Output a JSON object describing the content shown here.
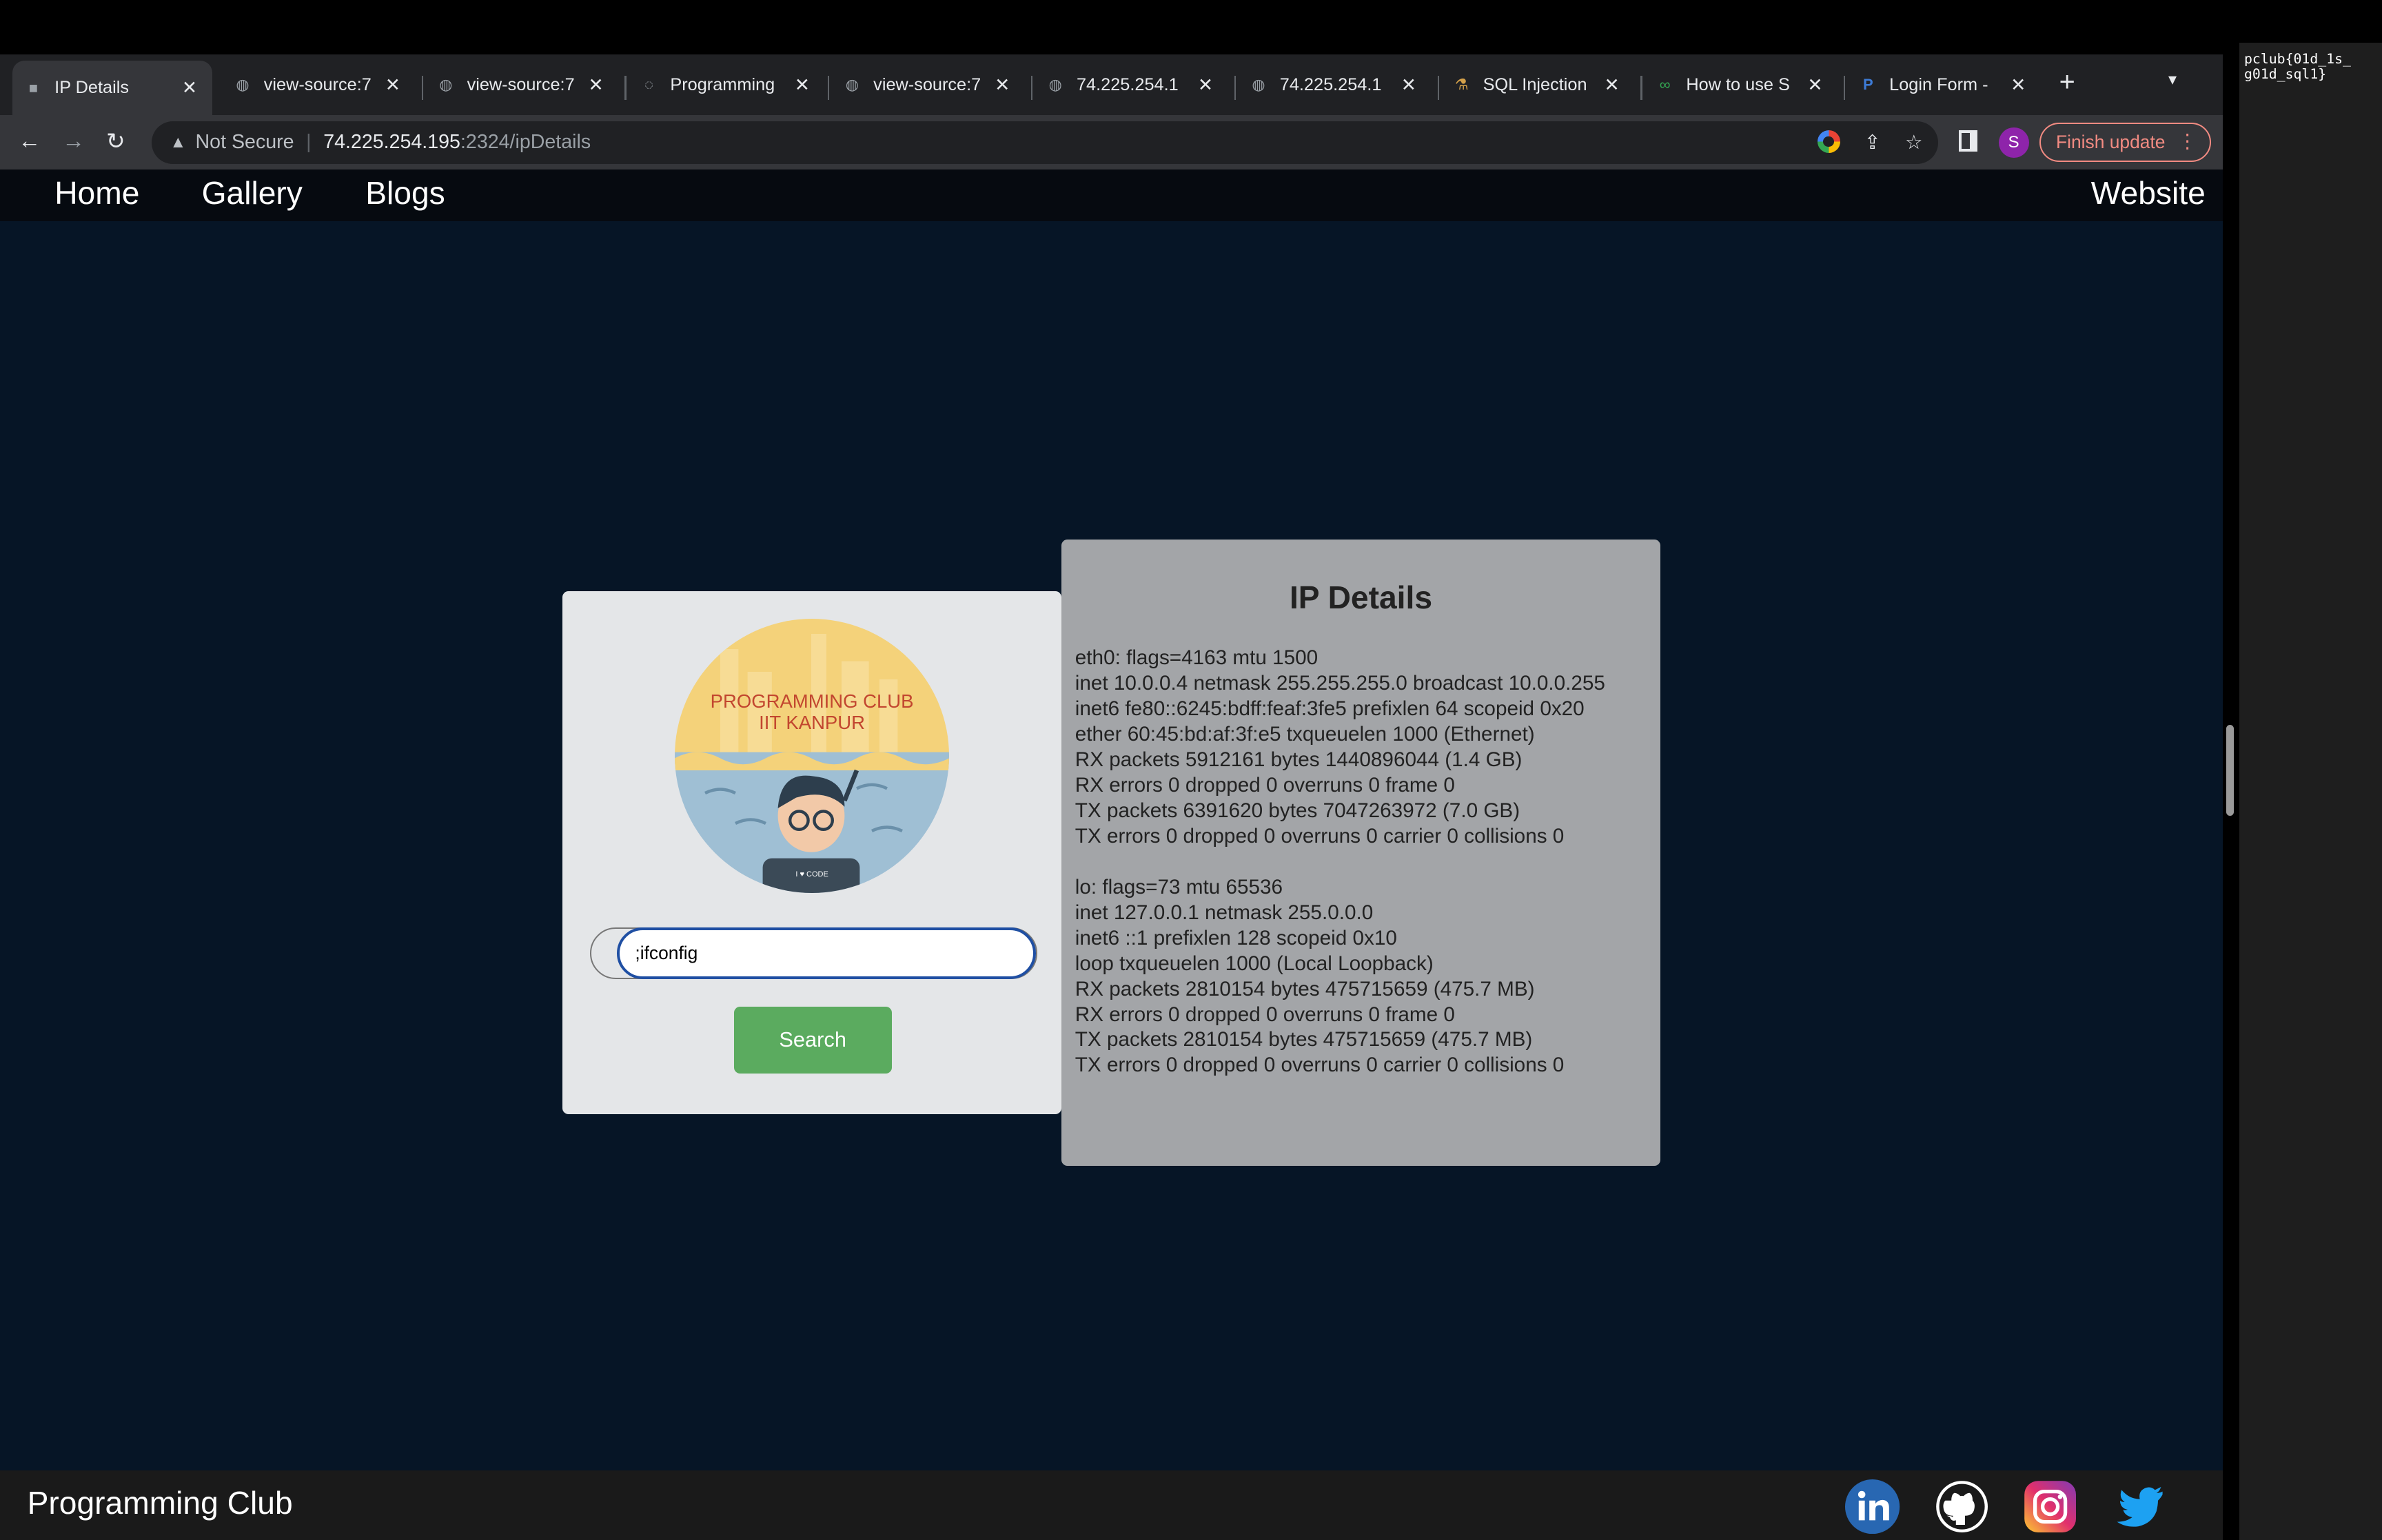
{
  "tabs": [
    {
      "title": "IP Details",
      "icon": "page-icon"
    },
    {
      "title": "view-source:7",
      "icon": "globe-icon"
    },
    {
      "title": "view-source:7",
      "icon": "globe-icon"
    },
    {
      "title": "Programming",
      "icon": "page-icon"
    },
    {
      "title": "view-source:7",
      "icon": "globe-icon"
    },
    {
      "title": "74.225.254.1",
      "icon": "globe-icon"
    },
    {
      "title": "74.225.254.1",
      "icon": "globe-icon"
    },
    {
      "title": "SQL Injection",
      "icon": "flask-icon"
    },
    {
      "title": "How to use S",
      "icon": "glasses-icon"
    },
    {
      "title": "Login Form - ",
      "icon": "p-icon"
    }
  ],
  "toolbar": {
    "not_secure": "Not Secure",
    "url_host": "74.225.254.195",
    "url_path": ":2324/ipDetails",
    "profile_initial": "S",
    "finish_update": "Finish update"
  },
  "site": {
    "nav": [
      "Home",
      "Gallery",
      "Blogs"
    ],
    "nav_right": "Website",
    "logo_line1": "PROGRAMMING CLUB",
    "logo_line2": "IIT KANPUR",
    "logo_shirt": "I ♥ CODE",
    "search_value": ";ifconfig",
    "search_button": "Search",
    "details_title": "IP Details",
    "details_text": "eth0: flags=4163 mtu 1500\ninet 10.0.0.4 netmask 255.255.255.0 broadcast 10.0.0.255\ninet6 fe80::6245:bdff:feaf:3fe5 prefixlen 64 scopeid 0x20\nether 60:45:bd:af:3f:e5 txqueuelen 1000 (Ethernet)\nRX packets 5912161 bytes 1440896044 (1.4 GB)\nRX errors 0 dropped 0 overruns 0 frame 0\nTX packets 6391620 bytes 7047263972 (7.0 GB)\nTX errors 0 dropped 0 overruns 0 carrier 0 collisions 0\n\nlo: flags=73 mtu 65536\ninet 127.0.0.1 netmask 255.0.0.0\ninet6 ::1 prefixlen 128 scopeid 0x10\nloop txqueuelen 1000 (Local Loopback)\nRX packets 2810154 bytes 475715659 (475.7 MB)\nRX errors 0 dropped 0 overruns 0 frame 0\nTX packets 2810154 bytes 475715659 (475.7 MB)\nTX errors 0 dropped 0 overruns 0 carrier 0 collisions 0",
    "footer_brand": "Programming Club",
    "social": [
      "linkedin-icon",
      "github-icon",
      "instagram-icon",
      "twitter-icon"
    ]
  },
  "side_note": "pclub{01d_1s_\ng01d_sql1}",
  "colors": {
    "page_bg": "#061526",
    "search_button": "#5bab5f",
    "details_bg": "#a3a5a8"
  }
}
